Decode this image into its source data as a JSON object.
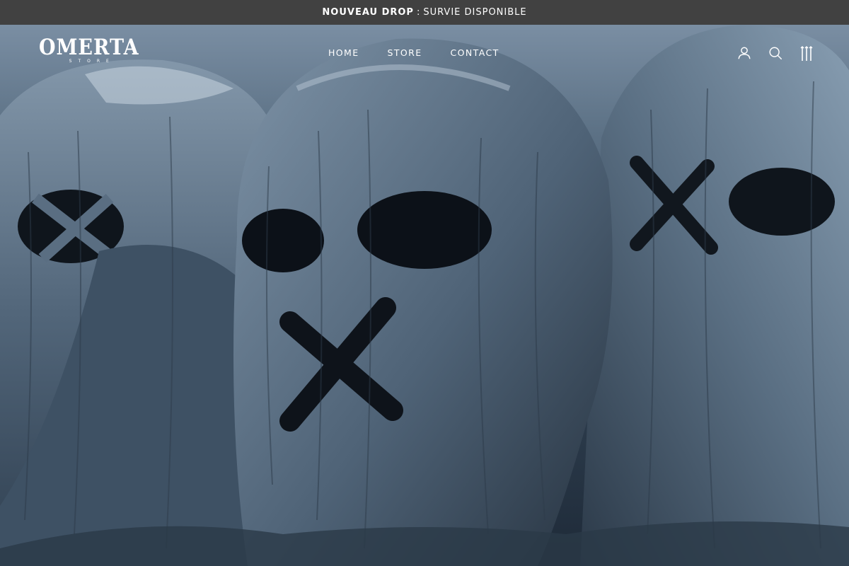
{
  "announcement": {
    "bold_text": "NOUVEAU DROP",
    "separator": ":",
    "text": "SURVIE DISPONIBLE"
  },
  "header": {
    "logo_text": "OMERTA",
    "logo_subtext": "STORE",
    "nav": [
      {
        "label": "HOME"
      },
      {
        "label": "STORE"
      },
      {
        "label": "CONTACT"
      }
    ],
    "icons": [
      "account-icon",
      "search-icon",
      "cart-icon"
    ]
  },
  "hero": {
    "image": "three-stone-masked-heads-with-x-marks"
  },
  "colors": {
    "announcement_bg": "#414141",
    "text": "#ffffff",
    "stone": "#5a6e82"
  }
}
